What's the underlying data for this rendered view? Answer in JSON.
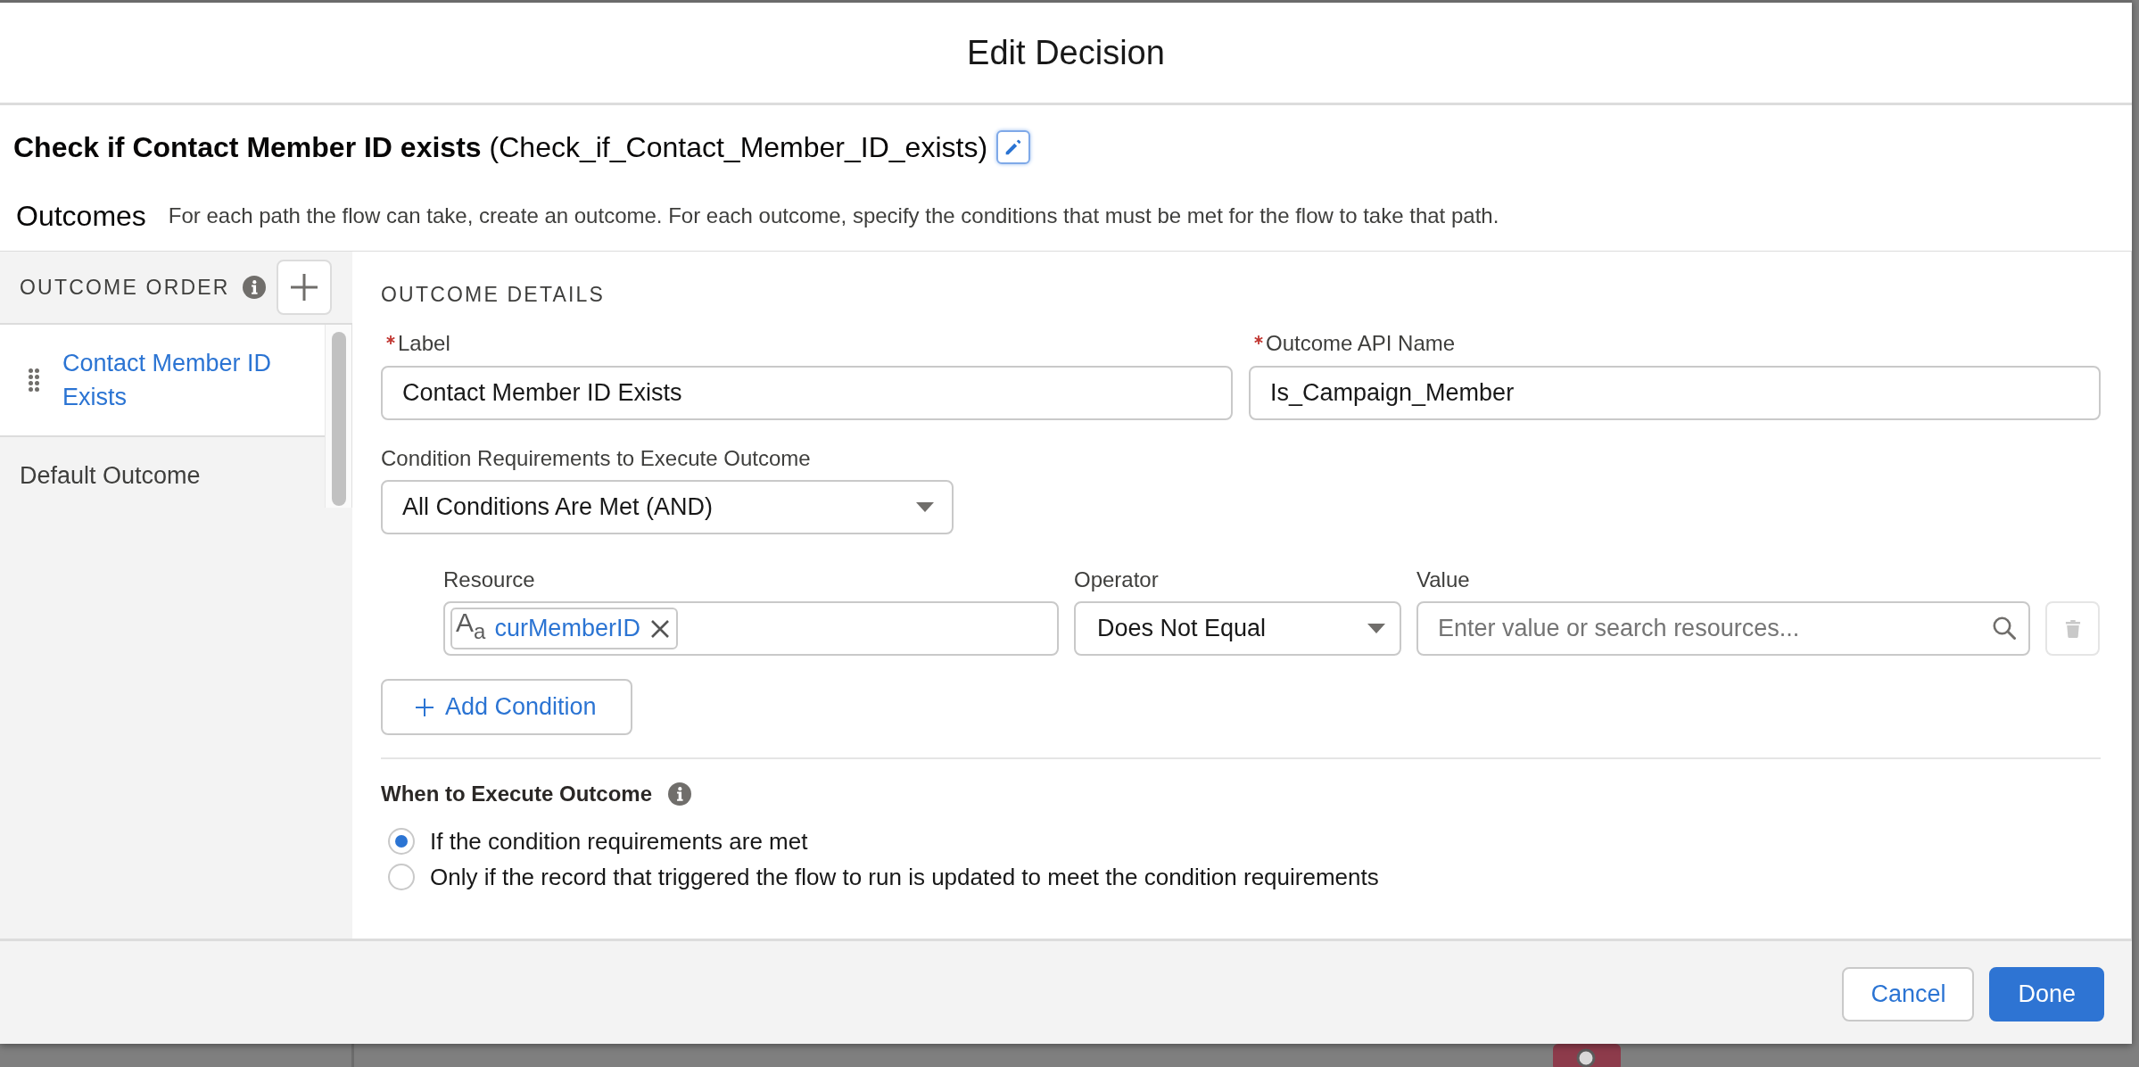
{
  "modal": {
    "title": "Edit Decision"
  },
  "element": {
    "label": "Check if Contact Member ID exists",
    "api_name": "(Check_if_Contact_Member_ID_exists)",
    "edit_button": {
      "focused": true
    }
  },
  "outcomes_intro": {
    "title": "Outcomes",
    "description": "For each path the flow can take, create an outcome. For each outcome, specify the conditions that must be met for the flow to take that path."
  },
  "outcome_order": {
    "heading": "OUTCOME ORDER",
    "items": [
      {
        "label": "Contact Member ID Exists",
        "selected": true,
        "draggable": true
      },
      {
        "label": "Default Outcome",
        "selected": false,
        "draggable": false
      }
    ]
  },
  "outcome_details": {
    "heading": "OUTCOME DETAILS",
    "fields": [
      {
        "label": "Label",
        "required": true,
        "value": "Contact Member ID Exists"
      },
      {
        "label": "Outcome API Name",
        "required": true,
        "value": "Is_Campaign_Member"
      }
    ],
    "condition_logic": {
      "label": "Condition Requirements to Execute Outcome",
      "value": "All Conditions Are Met (AND)"
    },
    "conditions": [
      {
        "resource": {
          "label": "Resource",
          "icon_text": "A$_{a}$",
          "value": "curMemberID"
        },
        "operator": {
          "label": "Operator",
          "value": "Does Not Equal"
        },
        "value": {
          "label": "Value",
          "placeholder": "Enter value or search resources..."
        },
        "delete_disabled": true
      }
    ],
    "add_condition": "Add Condition",
    "when_to_execute": {
      "title": "When to Execute Outcome",
      "options": [
        {
          "label": "If the condition requirements are met",
          "selected": true
        },
        {
          "label": "Only if the record that triggered the flow to run is updated to meet the condition requirements",
          "selected": false
        }
      ]
    }
  },
  "footer": {
    "buttons": [
      {
        "label": "Cancel",
        "kind": "neutral"
      },
      {
        "label": "Done",
        "kind": "brand"
      }
    ]
  }
}
